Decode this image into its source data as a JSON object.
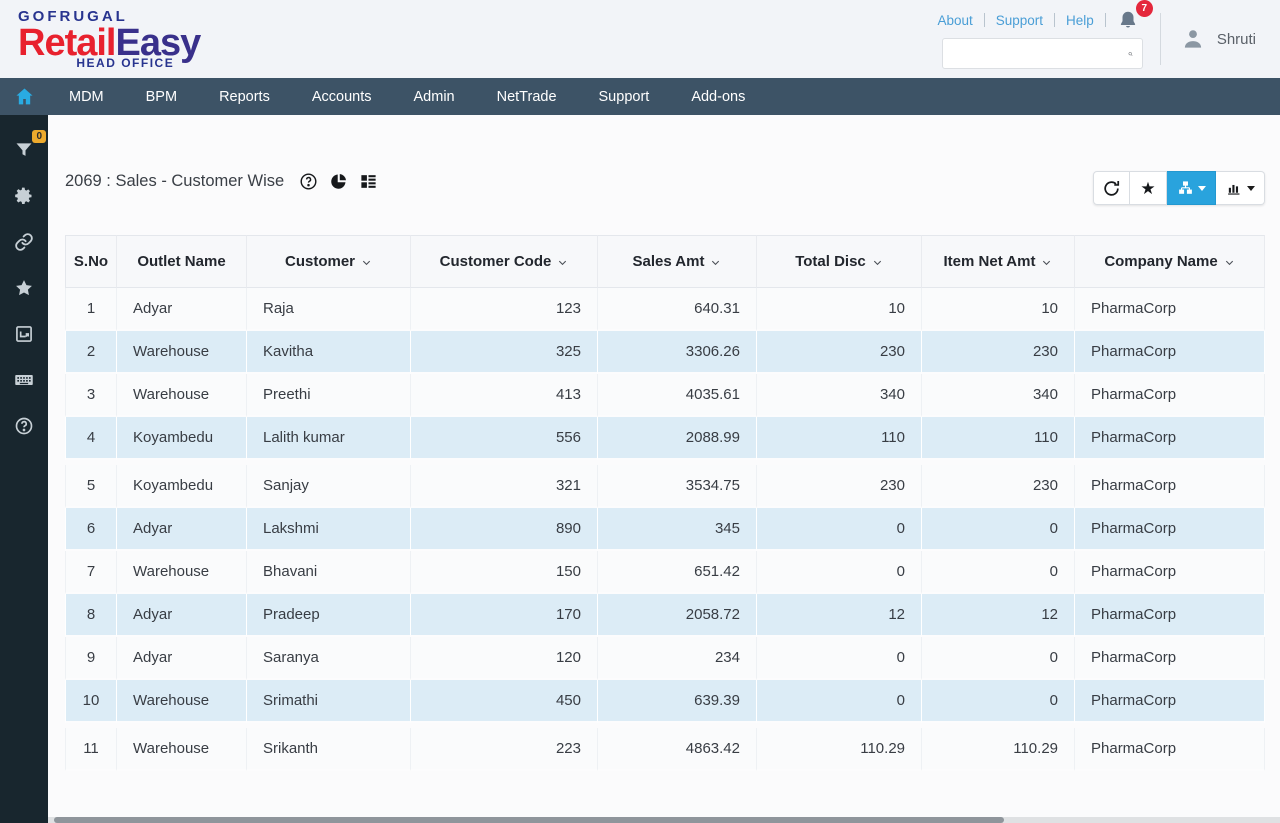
{
  "header": {
    "logo": {
      "brand": "GOFRUGAL",
      "product_part1": "Retail",
      "product_part2": "Easy",
      "suffix": "HEAD OFFICE"
    },
    "links": [
      "About",
      "Support",
      "Help"
    ],
    "notification_count": "7",
    "search": {
      "value": "",
      "placeholder": ""
    },
    "user_name": "Shruti"
  },
  "navbar": {
    "items": [
      "MDM",
      "BPM",
      "Reports",
      "Accounts",
      "Admin",
      "NetTrade",
      "Support",
      "Add-ons"
    ]
  },
  "sidebar": {
    "filter_badge": "0"
  },
  "report": {
    "title": "2069 : Sales - Customer Wise"
  },
  "table": {
    "columns": [
      {
        "label": "S.No",
        "sortable": false,
        "align": "center",
        "width": 52
      },
      {
        "label": "Outlet Name",
        "sortable": false,
        "align": "left",
        "width": 130
      },
      {
        "label": "Customer",
        "sortable": true,
        "align": "left",
        "width": 164
      },
      {
        "label": "Customer Code",
        "sortable": true,
        "align": "right",
        "width": 187
      },
      {
        "label": "Sales Amt",
        "sortable": true,
        "align": "right",
        "width": 159
      },
      {
        "label": "Total Disc",
        "sortable": true,
        "align": "right",
        "width": 165
      },
      {
        "label": "Item Net Amt",
        "sortable": true,
        "align": "right",
        "width": 153
      },
      {
        "label": "Company Name",
        "sortable": true,
        "align": "left",
        "width": 190
      }
    ],
    "rows": [
      [
        "1",
        "Adyar",
        "Raja",
        "123",
        "640.31",
        "10",
        "10",
        "PharmaCorp"
      ],
      [
        "2",
        "Warehouse",
        "Kavitha",
        "325",
        "3306.26",
        "230",
        "230",
        "PharmaCorp"
      ],
      [
        "3",
        "Warehouse",
        "Preethi",
        "413",
        "4035.61",
        "340",
        "340",
        "PharmaCorp"
      ],
      [
        "4",
        "Koyambedu",
        "Lalith kumar",
        "556",
        "2088.99",
        "110",
        "110",
        "PharmaCorp"
      ],
      [
        "5",
        "Koyambedu",
        "Sanjay",
        "321",
        "3534.75",
        "230",
        "230",
        "PharmaCorp"
      ],
      [
        "6",
        "Adyar",
        "Lakshmi",
        "890",
        "345",
        "0",
        "0",
        "PharmaCorp"
      ],
      [
        "7",
        "Warehouse",
        "Bhavani",
        "150",
        "651.42",
        "0",
        "0",
        "PharmaCorp"
      ],
      [
        "8",
        "Adyar",
        "Pradeep",
        "170",
        "2058.72",
        "12",
        "12",
        "PharmaCorp"
      ],
      [
        "9",
        "Adyar",
        "Saranya",
        "120",
        "234",
        "0",
        "0",
        "PharmaCorp"
      ],
      [
        "10",
        "Warehouse",
        "Srimathi",
        "450",
        "639.39",
        "0",
        "0",
        "PharmaCorp"
      ],
      [
        "11",
        "Warehouse",
        "Srikanth",
        "223",
        "4863.42",
        "110.29",
        "110.29",
        "PharmaCorp"
      ]
    ],
    "gap_before_rows": [
      4,
      10
    ]
  },
  "colors": {
    "accent_blue": "#29a3dd",
    "navbar_bg": "#3d5366",
    "sidebar_bg": "#18262e",
    "row_alt": "#dcecf6",
    "badge_red": "#e4273c",
    "badge_amber": "#edaa2d",
    "link_blue": "#4a9ed6",
    "logo_red": "#e8212e",
    "logo_navy": "#28348f",
    "logo_indigo": "#39308b"
  }
}
